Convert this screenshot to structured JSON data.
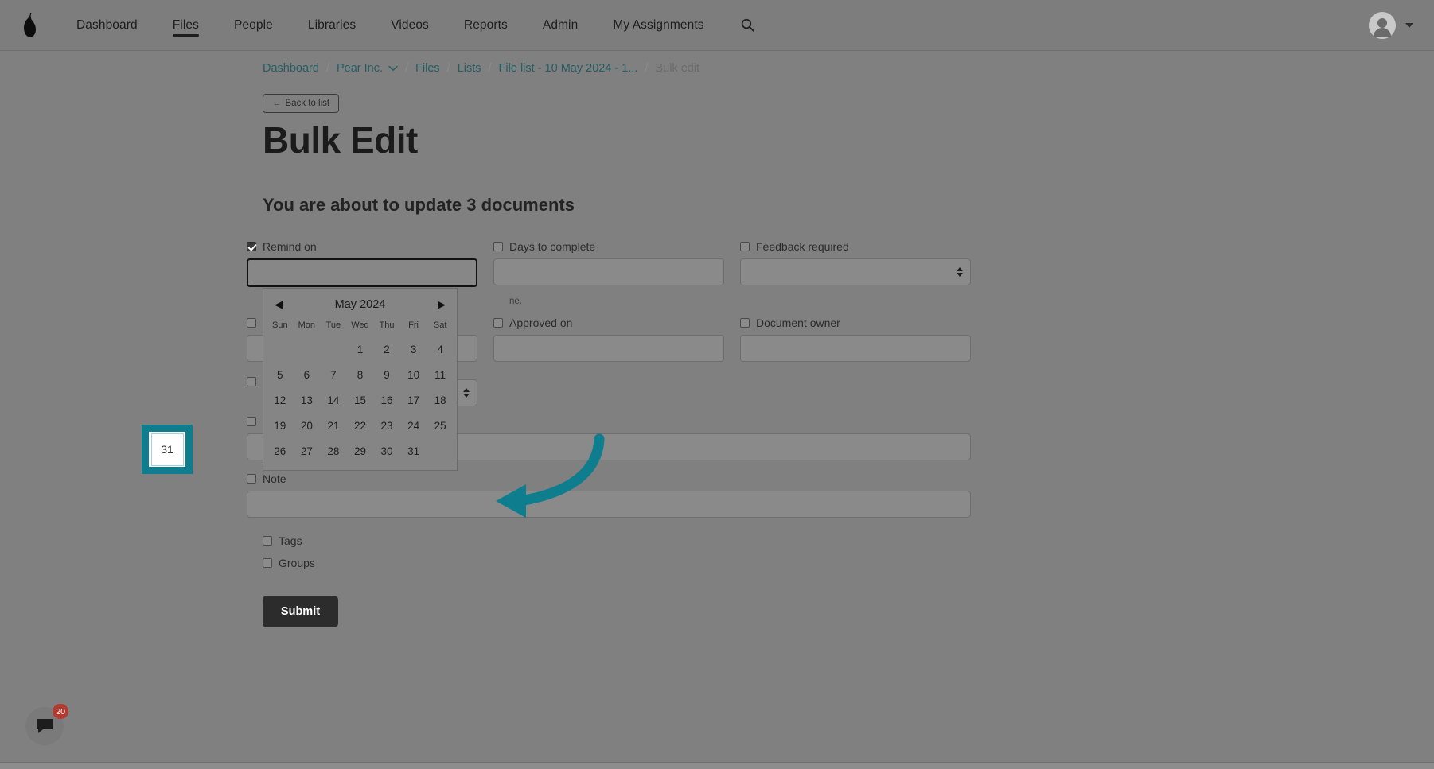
{
  "navbar": {
    "brand_icon": "pear-logo-icon",
    "links": [
      {
        "label": "Dashboard",
        "active": false
      },
      {
        "label": "Files",
        "active": true
      },
      {
        "label": "People",
        "active": false
      },
      {
        "label": "Libraries",
        "active": false
      },
      {
        "label": "Videos",
        "active": false
      },
      {
        "label": "Reports",
        "active": false
      },
      {
        "label": "Admin",
        "active": false
      },
      {
        "label": "My Assignments",
        "active": false
      }
    ],
    "search_icon": "search-icon",
    "account_icon": "user-avatar-icon",
    "account_caret": "chevron-down-icon"
  },
  "breadcrumb": {
    "items": [
      {
        "label": "Dashboard",
        "muted": false,
        "caret": false
      },
      {
        "label": "Pear Inc.",
        "muted": false,
        "caret": true
      },
      {
        "label": "Files",
        "muted": false,
        "caret": false
      },
      {
        "label": "Lists",
        "muted": false,
        "caret": false
      },
      {
        "label": "File list - 10 May 2024 - 1...",
        "muted": false,
        "caret": false
      },
      {
        "label": "Bulk edit",
        "muted": true,
        "caret": false
      }
    ],
    "separator": "/"
  },
  "back_button": {
    "arrow": "←",
    "label": "Back to list"
  },
  "page_title": "Bulk Edit",
  "sub_title": "You are about to update 3 documents",
  "form": {
    "fields": [
      {
        "name": "remind-on",
        "label": "Remind on",
        "checked": true,
        "type": "text",
        "value": "",
        "focused": true
      },
      {
        "name": "days-to-complete",
        "label": "Days to complete",
        "checked": false,
        "type": "text",
        "value": "",
        "focused": false
      },
      {
        "name": "feedback-required",
        "label": "Feedback required",
        "checked": false,
        "type": "select",
        "value": "",
        "focused": false
      },
      {
        "name": "review-date",
        "label": "",
        "checked": false,
        "type": "text",
        "value": "",
        "focused": false
      },
      {
        "name": "approved-on",
        "label": "Approved on",
        "checked": false,
        "type": "text",
        "value": "",
        "focused": false
      },
      {
        "name": "document-owner",
        "label": "Document owner",
        "checked": false,
        "type": "text",
        "value": "",
        "focused": false
      }
    ],
    "helper_text": "ne.",
    "row3_select_value": "",
    "row4_label": "",
    "note": {
      "label": "Note",
      "checked": false,
      "value": ""
    },
    "tags": {
      "label": "Tags",
      "checked": false
    },
    "groups": {
      "label": "Groups",
      "checked": false
    },
    "submit_label": "Submit"
  },
  "datepicker": {
    "prev_icon": "◀",
    "next_icon": "▶",
    "month_label": "May 2024",
    "weekdays": [
      "Sun",
      "Mon",
      "Tue",
      "Wed",
      "Thu",
      "Fri",
      "Sat"
    ],
    "weeks": [
      [
        "",
        "",
        "",
        "1",
        "2",
        "3",
        "4"
      ],
      [
        "5",
        "6",
        "7",
        "8",
        "9",
        "10",
        "11"
      ],
      [
        "12",
        "13",
        "14",
        "15",
        "16",
        "17",
        "18"
      ],
      [
        "19",
        "20",
        "21",
        "22",
        "23",
        "24",
        "25"
      ],
      [
        "26",
        "27",
        "28",
        "29",
        "30",
        "31",
        ""
      ]
    ],
    "highlighted_day": "31"
  },
  "annotation": {
    "highlight_color": "#0e7d8e",
    "highlight_target": "31",
    "arrow_icon": "curved-arrow-left-icon"
  },
  "chat_widget": {
    "icon": "chat-bubble-icon",
    "badge_count": "20"
  }
}
